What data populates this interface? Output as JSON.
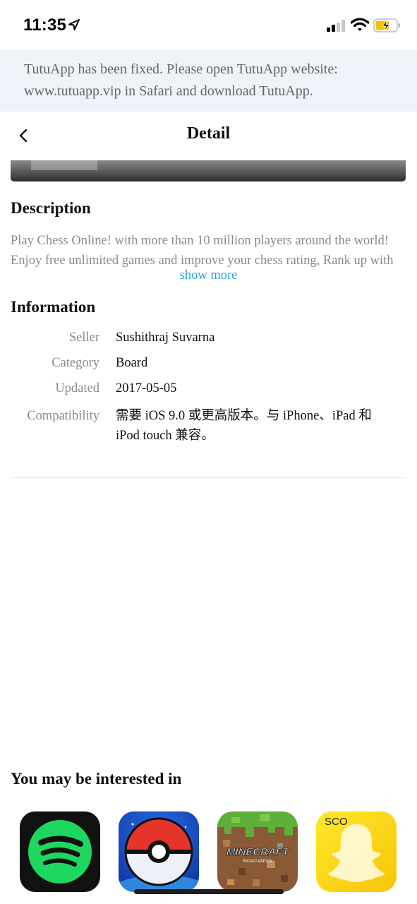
{
  "status_bar": {
    "time": "11:35",
    "icons": [
      "location-arrow-icon",
      "cellular-signal-icon",
      "wifi-icon",
      "battery-charging-icon"
    ],
    "battery_color": "#f5c400"
  },
  "banner": {
    "text": "TutuApp has been fixed. Please open TutuApp website: www.tutuapp.vip in Safari and download TutuApp."
  },
  "navbar": {
    "back_icon": "chevron-left-icon",
    "title": "Detail"
  },
  "description": {
    "title": "Description",
    "lines": [
      "Play Chess Online! with more than 10 million players around the world!",
      "Enjoy free unlimited games and improve your chess rating, Rank up with"
    ],
    "show_more": "show more",
    "link_color": "#2fa0e4"
  },
  "information": {
    "title": "Information",
    "rows": [
      {
        "label": "Seller",
        "value": "Sushithraj Suvarna"
      },
      {
        "label": "Category",
        "value": "Board"
      },
      {
        "label": "Updated",
        "value": "2017-05-05"
      },
      {
        "label": "Compatibility",
        "value": "需要 iOS 9.0 或更高版本。与 iPhone、iPad 和 iPod touch 兼容。"
      }
    ]
  },
  "recommendations": {
    "title": "You may be interested in",
    "apps": [
      {
        "name": "Spotify",
        "icon": "spotify-icon"
      },
      {
        "name": "Pokémon GO",
        "icon": "pokeball-icon"
      },
      {
        "name": "Minecraft Pocket Edition",
        "icon": "minecraft-icon",
        "label": "MINECRAFT",
        "sublabel": "POCKET EDITION"
      },
      {
        "name": "Snapchat",
        "icon": "snapchat-ghost-icon",
        "label": "SCO"
      }
    ]
  }
}
